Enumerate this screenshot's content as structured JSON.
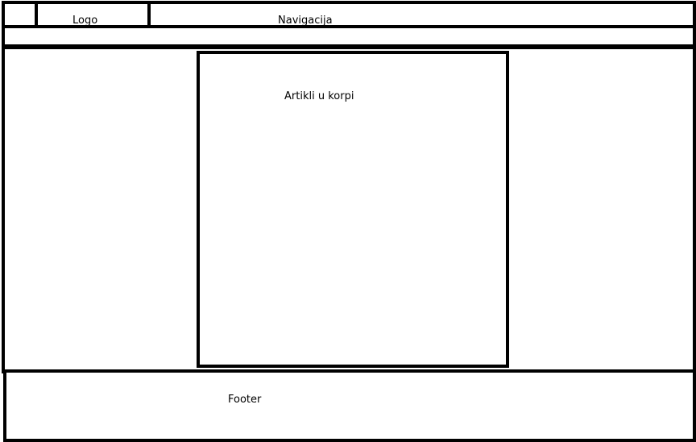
{
  "header": {
    "logo_label": "Logo",
    "nav_label": "Navigacija"
  },
  "main": {
    "cart_label": "Artikli u korpi"
  },
  "footer": {
    "label": "Footer"
  }
}
